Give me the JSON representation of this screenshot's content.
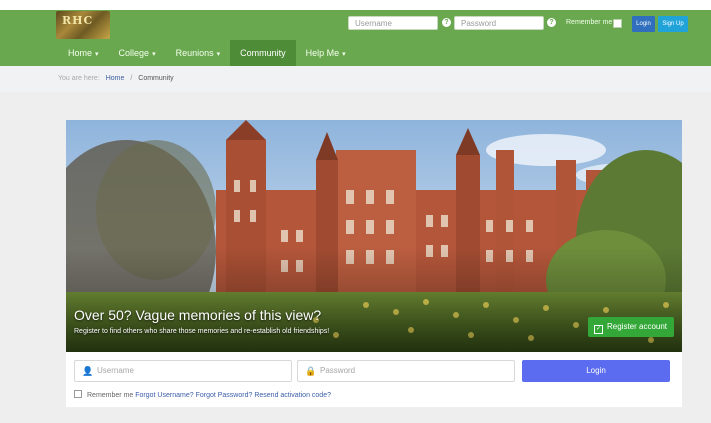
{
  "header": {
    "logo_text": "RHC",
    "nav": [
      {
        "label": "Home",
        "dropdown": true
      },
      {
        "label": "College",
        "dropdown": true
      },
      {
        "label": "Reunions",
        "dropdown": true
      },
      {
        "label": "Community",
        "dropdown": false,
        "active": true
      },
      {
        "label": "Help Me",
        "dropdown": true
      }
    ],
    "username_placeholder": "Username",
    "password_placeholder": "Password",
    "remember_label": "Remember me",
    "login_label": "Login",
    "signup_label": "Sign Up"
  },
  "breadcrumb": {
    "prefix": "You are here:",
    "home": "Home",
    "current": "Community"
  },
  "hero": {
    "title": "Over 50? Vague memories of this view?",
    "subtitle": "Register to find others who share those memories and re-establish old friendships!",
    "register_label": "Register account"
  },
  "login_form": {
    "username_placeholder": "Username",
    "password_placeholder": "Password",
    "login_label": "Login",
    "remember_label": "Remember me",
    "forgot_username": "Forgot Username?",
    "forgot_password": "Forgot Password?",
    "resend_activation": "Resend activation code?"
  },
  "colors": {
    "header_green": "#6aa84f",
    "active_nav": "#4e8c38",
    "register_green": "#33a838",
    "login_blue": "#5b6cf0",
    "signup_blue": "#20a3d8"
  }
}
